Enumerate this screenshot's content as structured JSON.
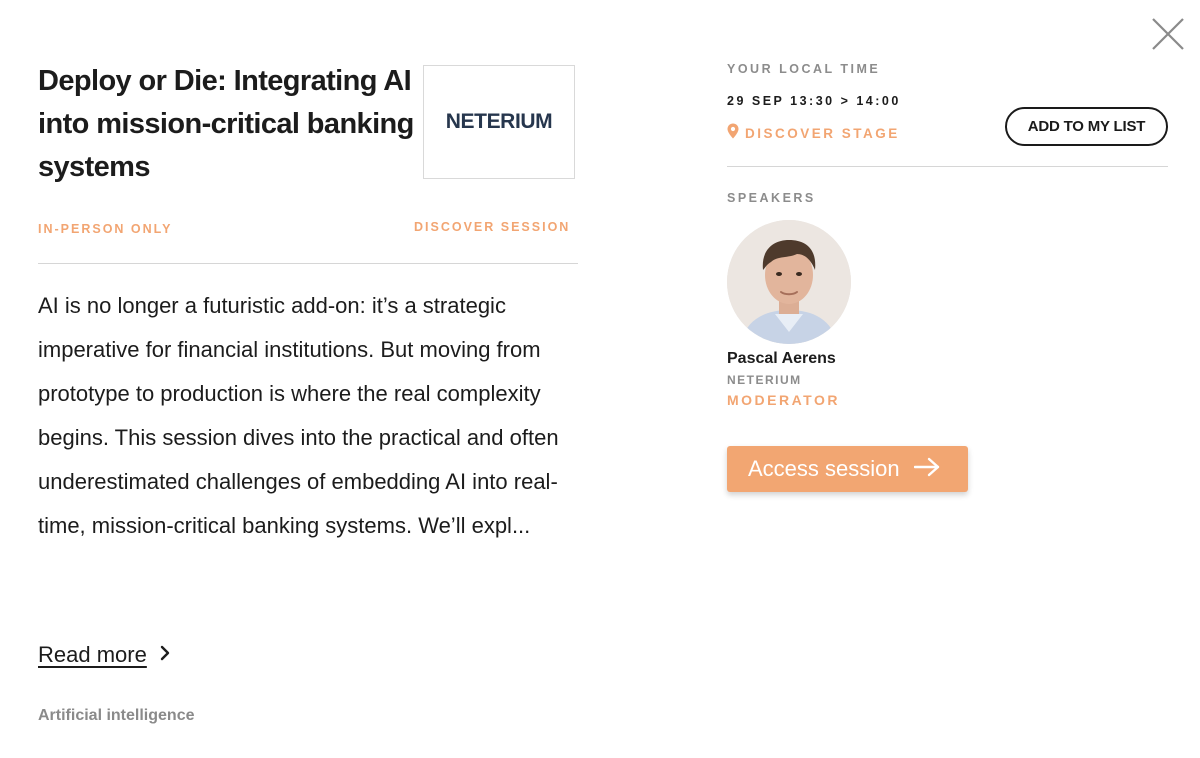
{
  "session": {
    "title": "Deploy or Die: Integrating AI into mission-critical banking systems",
    "logo_text": "NETERIUM",
    "format_tag": "IN-PERSON ONLY",
    "type_tag": "DISCOVER SESSION",
    "description": "AI is no longer a futuristic add-on: it’s a strategic imperative for financial institutions. But moving from prototype to production is where the real complexity begins. This session dives into the practical and often underestimated challenges of embedding AI into real-time, mission-critical banking systems. We’ll expl...",
    "read_more_label": "Read more",
    "topic": "Artificial intelligence"
  },
  "schedule": {
    "time_label": "YOUR LOCAL TIME",
    "time_value": "29 SEP 13:30 > 14:00",
    "stage": "DISCOVER STAGE",
    "add_button_label": "ADD TO MY LIST"
  },
  "speakers": {
    "label": "SPEAKERS",
    "items": [
      {
        "name": "Pascal Aerens",
        "company": "NETERIUM",
        "role": "MODERATOR"
      }
    ]
  },
  "access_button_label": "Access session",
  "icons": {
    "close": "close-icon",
    "location": "location-pin-icon",
    "chevron": "chevron-right-icon",
    "arrow": "arrow-right-icon"
  },
  "colors": {
    "accent": "#f2a572",
    "text": "#1c1c1c",
    "muted": "#8c8c8c",
    "logo": "#26364d"
  }
}
